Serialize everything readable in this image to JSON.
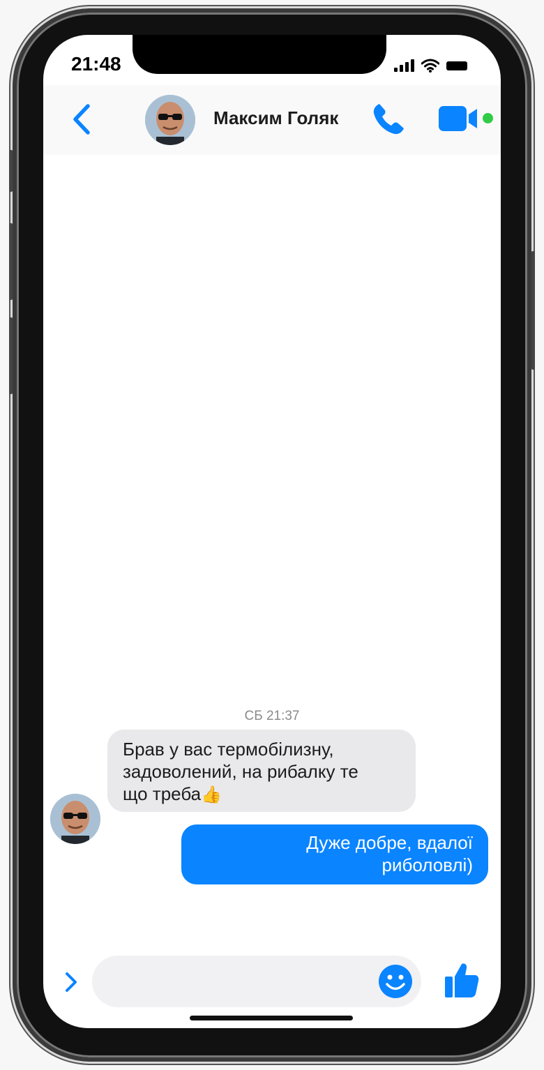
{
  "status_bar": {
    "time": "21:48"
  },
  "header": {
    "contact_name": "Максим Голяк"
  },
  "conversation": {
    "timestamp": "СБ 21:37",
    "incoming": {
      "line1": "Брав у вас термобілизну,",
      "line2": "задоволений, на рибалку те",
      "line3": "що треба",
      "emoji": "👍"
    },
    "outgoing": {
      "line1": "Дуже добре, вдалої",
      "line2": "риболовлі)"
    }
  },
  "composer": {
    "placeholder": ""
  },
  "icons": {
    "back": "chevron-left-icon",
    "call": "phone-icon",
    "video": "video-camera-icon",
    "expand": "chevron-right-icon",
    "emoji": "smiley-icon",
    "like": "thumbs-up-icon"
  },
  "colors": {
    "accent": "#0a84ff",
    "incoming_bubble": "#e9e9eb",
    "online": "#31cc46"
  }
}
